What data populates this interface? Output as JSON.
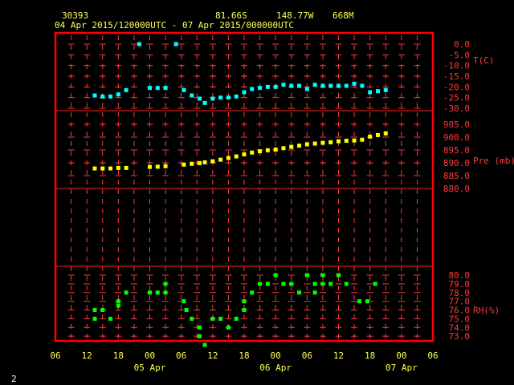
{
  "header": {
    "station": "30393",
    "lat": "81.66S",
    "lon": "148.77W",
    "elev": "668M",
    "period": "04 Apr 2015/120000UTC - 07 Apr 2015/000000UTC"
  },
  "page_number": "2",
  "colors": {
    "background": "#000000",
    "frame": "#ff0000",
    "grid": "#ff3b3b",
    "header_text": "#ffff55",
    "temperature": "#00ffff",
    "pressure": "#ffff00",
    "rh": "#00ff00"
  },
  "chart_data": {
    "type": "scatter",
    "x_axis": {
      "unit": "hours since 04 Apr 2015 06UTC",
      "range": [
        0,
        72
      ],
      "tick_labels": [
        "06",
        "12",
        "18",
        "00",
        "06",
        "12",
        "18",
        "00",
        "06",
        "12",
        "18",
        "00",
        "06"
      ],
      "date_labels": [
        {
          "text": "05 Apr",
          "x": 18
        },
        {
          "text": "06 Apr",
          "x": 42
        },
        {
          "text": "07 Apr",
          "x": 66
        }
      ]
    },
    "panels": [
      {
        "label": "T(C)",
        "ylim": [
          -30,
          0
        ],
        "ticks": [
          "0.0",
          "-5.0",
          "-10.0",
          "-15.0",
          "-20.0",
          "-25.0",
          "-30.0"
        ],
        "tick_values": [
          0,
          -5,
          -10,
          -15,
          -20,
          -25,
          -30
        ],
        "color": "#00ffff",
        "points": [
          [
            7.5,
            -24.0
          ],
          [
            9.0,
            -24.5
          ],
          [
            10.5,
            -24.5
          ],
          [
            12.0,
            -23.5
          ],
          [
            13.5,
            -21.5
          ],
          [
            16.0,
            0.0
          ],
          [
            18.0,
            -20.5
          ],
          [
            19.5,
            -20.5
          ],
          [
            21.0,
            -20.5
          ],
          [
            23.0,
            0.0
          ],
          [
            24.5,
            -21.5
          ],
          [
            26.0,
            -24.0
          ],
          [
            27.5,
            -25.5
          ],
          [
            28.5,
            -27.5
          ],
          [
            30.0,
            -25.5
          ],
          [
            31.5,
            -25.0
          ],
          [
            33.0,
            -25.0
          ],
          [
            34.5,
            -24.5
          ],
          [
            36.0,
            -22.5
          ],
          [
            37.5,
            -21.0
          ],
          [
            39.0,
            -20.5
          ],
          [
            40.5,
            -20.0
          ],
          [
            42.0,
            -20.0
          ],
          [
            43.5,
            -19.0
          ],
          [
            45.0,
            -19.5
          ],
          [
            46.5,
            -19.5
          ],
          [
            48.0,
            -21.0
          ],
          [
            49.5,
            -19.0
          ],
          [
            51.0,
            -19.5
          ],
          [
            52.5,
            -19.5
          ],
          [
            54.0,
            -19.5
          ],
          [
            55.5,
            -19.5
          ],
          [
            57.0,
            -18.5
          ],
          [
            58.5,
            -19.5
          ],
          [
            60.0,
            -22.5
          ],
          [
            61.5,
            -22.0
          ],
          [
            63.0,
            -21.5
          ]
        ]
      },
      {
        "label": "Pre (mb)",
        "ylim": [
          880,
          905
        ],
        "ticks": [
          "905.0",
          "900.0",
          "895.0",
          "890.0",
          "885.0",
          "880.0"
        ],
        "tick_values": [
          905,
          900,
          895,
          890,
          885,
          880
        ],
        "color": "#ffff00",
        "points": [
          [
            7.5,
            887.8
          ],
          [
            9.0,
            887.8
          ],
          [
            10.5,
            887.8
          ],
          [
            12.0,
            888.0
          ],
          [
            13.5,
            888.0
          ],
          [
            18.0,
            888.4
          ],
          [
            19.5,
            888.5
          ],
          [
            21.0,
            888.7
          ],
          [
            24.5,
            889.3
          ],
          [
            26.0,
            889.6
          ],
          [
            27.5,
            889.9
          ],
          [
            28.5,
            890.2
          ],
          [
            30.0,
            890.6
          ],
          [
            31.5,
            891.2
          ],
          [
            33.0,
            891.9
          ],
          [
            34.5,
            892.5
          ],
          [
            36.0,
            893.3
          ],
          [
            37.5,
            894.0
          ],
          [
            39.0,
            894.5
          ],
          [
            40.5,
            894.9
          ],
          [
            42.0,
            895.2
          ],
          [
            43.5,
            895.7
          ],
          [
            45.0,
            896.2
          ],
          [
            46.5,
            896.7
          ],
          [
            48.0,
            897.2
          ],
          [
            49.5,
            897.5
          ],
          [
            51.0,
            897.8
          ],
          [
            52.5,
            898.0
          ],
          [
            54.0,
            898.4
          ],
          [
            55.5,
            898.6
          ],
          [
            57.0,
            898.7
          ],
          [
            58.5,
            899.0
          ],
          [
            60.0,
            900.2
          ],
          [
            61.5,
            900.8
          ],
          [
            63.0,
            901.5
          ]
        ]
      },
      {
        "label": "RH(%)",
        "ylim": [
          72,
          80
        ],
        "ticks": [
          "80.0",
          "79.0",
          "78.0",
          "77.0",
          "76.0",
          "75.0",
          "74.0",
          "73.0",
          "72.0"
        ],
        "tick_values": [
          80,
          79,
          78,
          77,
          76,
          75,
          74,
          73,
          72
        ],
        "color": "#00ff00",
        "points": [
          [
            7.5,
            76.0
          ],
          [
            7.5,
            75.0
          ],
          [
            9.0,
            76.0
          ],
          [
            10.5,
            75.0
          ],
          [
            12.0,
            77.0
          ],
          [
            12.0,
            76.5
          ],
          [
            13.5,
            78.0
          ],
          [
            18.0,
            78.0
          ],
          [
            19.5,
            78.0
          ],
          [
            21.0,
            78.0
          ],
          [
            21.0,
            79.0
          ],
          [
            24.5,
            77.0
          ],
          [
            25.0,
            76.0
          ],
          [
            26.0,
            75.0
          ],
          [
            27.5,
            74.0
          ],
          [
            27.5,
            73.0
          ],
          [
            28.5,
            72.0
          ],
          [
            30.0,
            75.0
          ],
          [
            31.5,
            75.0
          ],
          [
            33.0,
            74.0
          ],
          [
            34.5,
            75.0
          ],
          [
            36.0,
            76.0
          ],
          [
            36.0,
            77.0
          ],
          [
            37.5,
            78.0
          ],
          [
            39.0,
            79.0
          ],
          [
            40.5,
            79.0
          ],
          [
            42.0,
            80.0
          ],
          [
            43.5,
            79.0
          ],
          [
            45.0,
            79.0
          ],
          [
            46.5,
            78.0
          ],
          [
            48.0,
            80.0
          ],
          [
            49.5,
            79.0
          ],
          [
            49.5,
            78.0
          ],
          [
            51.0,
            80.0
          ],
          [
            51.0,
            79.0
          ],
          [
            52.5,
            79.0
          ],
          [
            54.0,
            80.0
          ],
          [
            55.5,
            79.0
          ],
          [
            58.0,
            77.0
          ],
          [
            59.5,
            77.0
          ],
          [
            61.0,
            79.0
          ]
        ]
      }
    ]
  }
}
